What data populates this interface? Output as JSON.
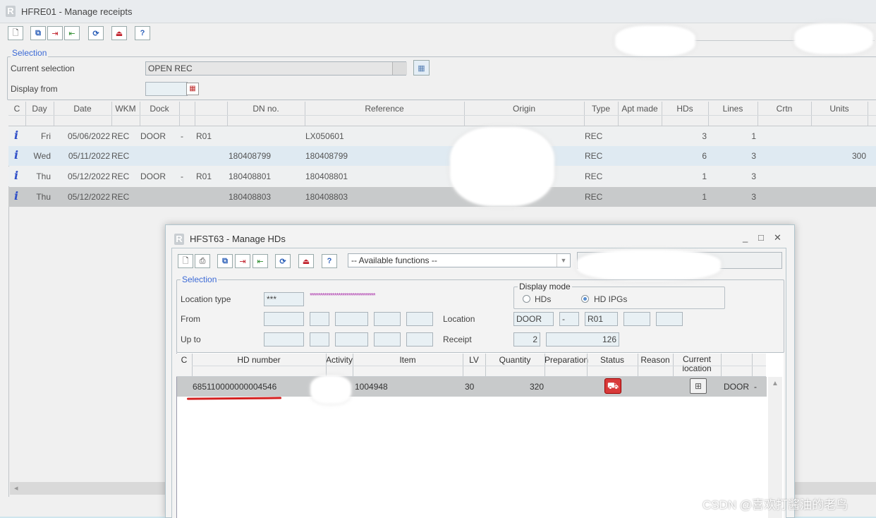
{
  "main": {
    "logo": "R",
    "title": "HFRE01 - Manage receipts",
    "selection_legend": "Selection",
    "current_selection_label": "Current selection",
    "current_selection_value": "OPEN REC",
    "display_from_label": "Display from",
    "grid": {
      "headers": [
        "C",
        "Day",
        "Date",
        "WKM",
        "Dock",
        "",
        "",
        "DN no.",
        "Reference",
        "Origin",
        "Type",
        "Apt made",
        "HDs",
        "Lines",
        "Crtn",
        "Units"
      ],
      "rows": [
        {
          "day": "Fri",
          "date": "05/06/2022",
          "wkm": "REC",
          "dock": "DOOR",
          "d2": "-",
          "d3": "R01",
          "dn": "",
          "ref": "LX050601",
          "type": "REC",
          "hds": "3",
          "lines": "1",
          "units": ""
        },
        {
          "day": "Wed",
          "date": "05/11/2022",
          "wkm": "REC",
          "dock": "",
          "d2": "",
          "d3": "",
          "dn": "180408799",
          "ref": "180408799",
          "type": "REC",
          "hds": "6",
          "lines": "3",
          "units": "300"
        },
        {
          "day": "Thu",
          "date": "05/12/2022",
          "wkm": "REC",
          "dock": "DOOR",
          "d2": "-",
          "d3": "R01",
          "dn": "180408801",
          "ref": "180408801",
          "type": "REC",
          "hds": "1",
          "lines": "3",
          "units": ""
        },
        {
          "day": "Thu",
          "date": "05/12/2022",
          "wkm": "REC",
          "dock": "",
          "d2": "",
          "d3": "",
          "dn": "180408803",
          "ref": "180408803",
          "type": "REC",
          "hds": "1",
          "lines": "3",
          "units": ""
        }
      ],
      "info_icon": "i"
    }
  },
  "dialog": {
    "logo": "R",
    "title": "HFST63 - Manage HDs",
    "functions_select": "-- Available functions --",
    "selection_legend": "Selection",
    "location_type_label": "Location type",
    "location_type_value": "***",
    "location_type_stars": "********************************",
    "from_label": "From",
    "upto_label": "Up to",
    "location_label": "Location",
    "location_values": [
      "DOOR",
      "-",
      "R01"
    ],
    "receipt_label": "Receipt",
    "receipt_values": [
      "2",
      "126"
    ],
    "display_mode_legend": "Display mode",
    "mode_hds": "HDs",
    "mode_hd_ipgs": "HD IPGs",
    "grid": {
      "headers": [
        "C",
        "HD number",
        "Activity",
        "Item",
        "LV",
        "Quantity",
        "Preparation",
        "Status",
        "Reason",
        "Current location"
      ],
      "row": {
        "hd_number": "685110000000004546",
        "item": "1004948",
        "lv": "30",
        "quantity": "320",
        "location": "DOOR",
        "dash": "-"
      }
    }
  },
  "watermark": "CSDN @喜欢打酱油的老鸟"
}
